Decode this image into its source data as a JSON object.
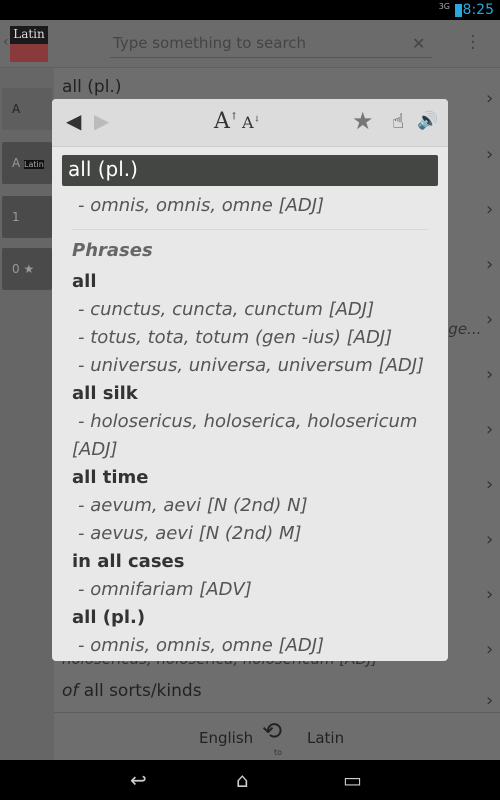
{
  "status": {
    "network": "3G",
    "time": "8:25"
  },
  "actionbar": {
    "logo": "Latin",
    "search_placeholder": "Type something to search"
  },
  "sidebar": [
    {
      "label": "A",
      "sub": ""
    },
    {
      "label": "A",
      "sub": "Latin"
    },
    {
      "label": "1",
      "sub": ""
    },
    {
      "label": "0",
      "sub": ""
    }
  ],
  "list": {
    "items": [
      "all (pl.)",
      "...ge...",
      "holosericus, holoserica, holosericum [ADJ]"
    ],
    "last_prefix": "of",
    "last_term": "all sorts/kinds"
  },
  "bottom": {
    "from": "English",
    "to_label": "to",
    "to": "Latin"
  },
  "dialog": {
    "title": "all (pl.)",
    "main": "- omnis, omnis, omne [ADJ]",
    "phrases_header": "Phrases",
    "lines": [
      {
        "t": "all",
        "h": true
      },
      {
        "t": "- cunctus, cuncta, cunctum [ADJ]"
      },
      {
        "t": "- totus, tota, totum (gen -ius) [ADJ]"
      },
      {
        "t": "- universus, universa, universum [ADJ]"
      },
      {
        "t": "all silk",
        "h": true
      },
      {
        "t": "- holosericus, holoserica, holosericum"
      },
      {
        "t": "[ADJ]"
      },
      {
        "t": "all time",
        "h": true
      },
      {
        "t": "- aevum, aevi [N (2nd) N]"
      },
      {
        "t": "- aevus, aevi [N (2nd) M]"
      },
      {
        "t": "in all cases",
        "h": true
      },
      {
        "t": "- omnifariam [ADV]"
      },
      {
        "t": "all (pl.)",
        "h": true
      },
      {
        "t": "- omnis, omnis, omne [ADJ]"
      }
    ]
  }
}
